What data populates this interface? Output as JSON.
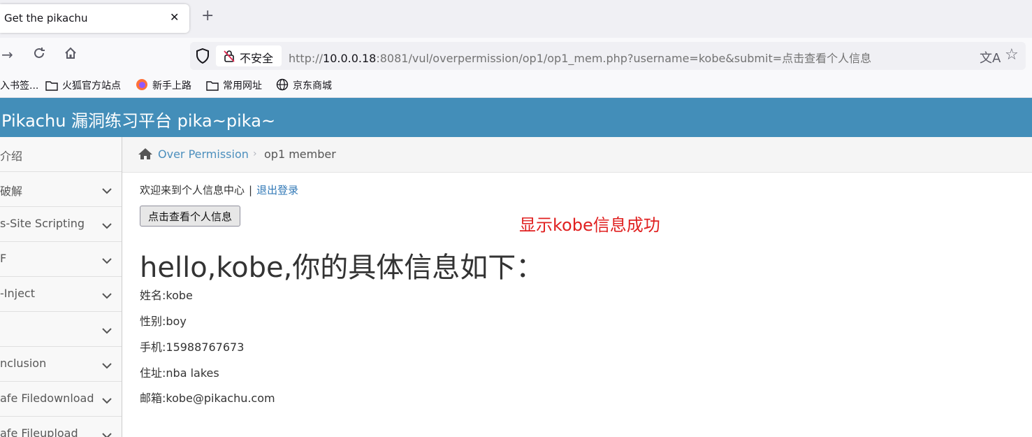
{
  "browser": {
    "tab_title": "Get the pikachu",
    "security_label": "不安全",
    "url_prefix": "http://",
    "url_host": "10.0.0.18",
    "url_rest": ":8081/vul/overpermission/op1/op1_mem.php?username=kobe&submit=点击查看个人信息",
    "bookmarks": [
      {
        "label": "入书签...",
        "icon": "import-icon"
      },
      {
        "label": "火狐官方站点",
        "icon": "folder-icon"
      },
      {
        "label": "新手上路",
        "icon": "firefox-icon"
      },
      {
        "label": "常用网址",
        "icon": "folder-icon"
      },
      {
        "label": "京东商城",
        "icon": "globe-icon"
      }
    ]
  },
  "header": {
    "brand": "Pikachu 漏洞练习平台 pika~pika~"
  },
  "sidebar": {
    "items": [
      {
        "label": "介绍"
      },
      {
        "label": "破解"
      },
      {
        "label": "s-Site Scripting"
      },
      {
        "label": "F"
      },
      {
        "label": "-Inject"
      },
      {
        "label": ""
      },
      {
        "label": "nclusion"
      },
      {
        "label": "afe Filedownload"
      },
      {
        "label": "afe Fileupload"
      }
    ]
  },
  "breadcrumb": {
    "link": "Over Permission",
    "current": "op1 member"
  },
  "main": {
    "welcome_text": "欢迎来到个人信息中心",
    "separator": "|",
    "logout_text": "退出登录",
    "view_button": "点击查看个人信息",
    "annotation": "显示kobe信息成功",
    "heading": "hello,kobe,你的具体信息如下：",
    "info": [
      "姓名:kobe",
      "性别:boy",
      "手机:15988767673",
      "住址:nba lakes",
      "邮箱:kobe@pikachu.com"
    ]
  },
  "colors": {
    "header_bg": "#438eb9",
    "link": "#4c8fbd",
    "annotation": "#e02020"
  }
}
